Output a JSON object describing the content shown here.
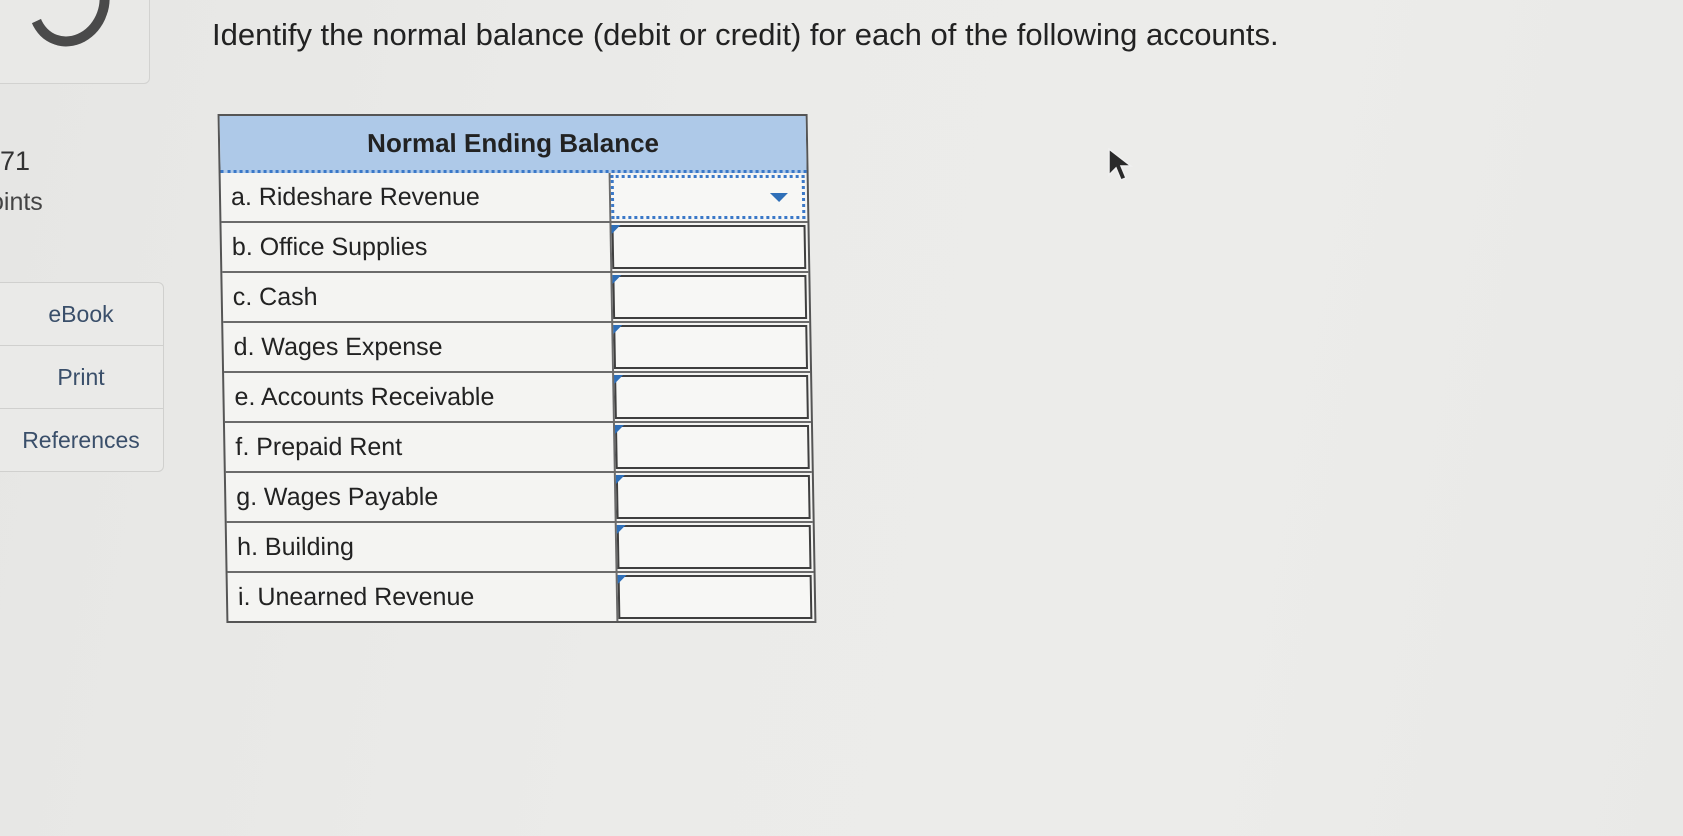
{
  "sidebar": {
    "question_number": "71",
    "points_label": "oints",
    "nav_items": [
      {
        "label": "eBook"
      },
      {
        "label": "Print"
      },
      {
        "label": "References"
      }
    ]
  },
  "question": {
    "text": "Identify the normal balance (debit or credit) for each of the following accounts."
  },
  "table": {
    "header": "Normal Ending Balance",
    "rows": [
      {
        "account": "a. Rideshare Revenue",
        "selected": ""
      },
      {
        "account": "b. Office Supplies",
        "selected": ""
      },
      {
        "account": "c. Cash",
        "selected": ""
      },
      {
        "account": "d. Wages Expense",
        "selected": ""
      },
      {
        "account": "e. Accounts Receivable",
        "selected": ""
      },
      {
        "account": "f. Prepaid Rent",
        "selected": ""
      },
      {
        "account": "g. Wages Payable",
        "selected": ""
      },
      {
        "account": "h. Building",
        "selected": ""
      },
      {
        "account": "i. Unearned Revenue",
        "selected": ""
      }
    ]
  },
  "colors": {
    "header_bg": "#aec9e8",
    "accent_blue": "#2f6fb8",
    "nav_text": "#3a4f6a"
  },
  "icons": {
    "cursor": "mouse-pointer-icon",
    "dropdown": "chevron-down-icon"
  }
}
